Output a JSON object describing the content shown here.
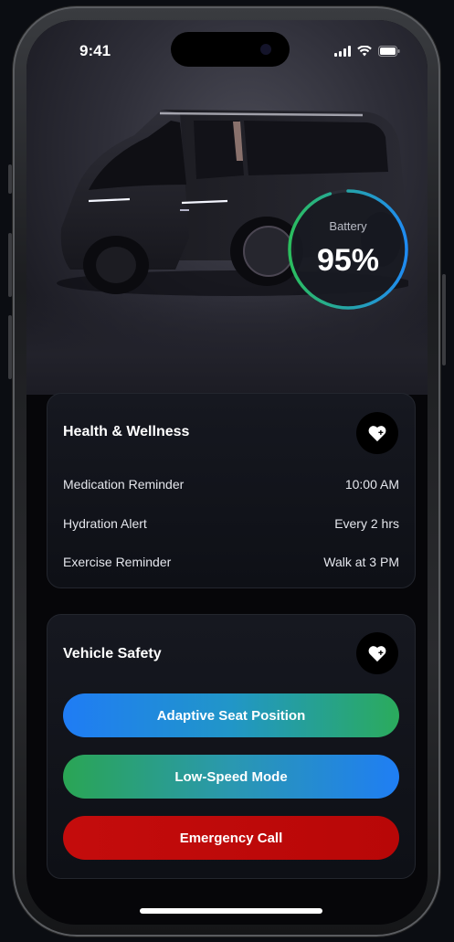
{
  "status_bar": {
    "time": "9:41"
  },
  "vehicle": {
    "battery_label": "Battery",
    "battery_value": "95%",
    "battery_level": 0.95
  },
  "health": {
    "title": "Health & Wellness",
    "icon": "heart-icon",
    "rows": [
      {
        "label": "Medication Reminder",
        "value": "10:00 AM"
      },
      {
        "label": "Hydration Alert",
        "value": "Every 2 hrs"
      },
      {
        "label": "Exercise Reminder",
        "value": "Walk at 3 PM"
      }
    ]
  },
  "safety": {
    "title": "Vehicle Safety",
    "icon": "heart-icon",
    "buttons": [
      {
        "label": "Adaptive Seat Position"
      },
      {
        "label": "Low-Speed Mode"
      },
      {
        "label": "Emergency Call"
      }
    ]
  },
  "colors": {
    "accent_blue": "#1f7cf5",
    "accent_green": "#2bab5c",
    "emergency_red": "#c40c0c",
    "background": "#060609"
  }
}
